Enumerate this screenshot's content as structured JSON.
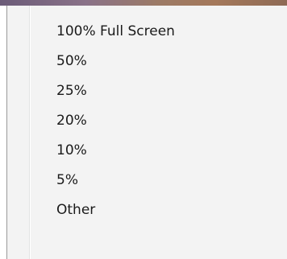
{
  "menu": {
    "items": [
      {
        "label": "100% Full Screen"
      },
      {
        "label": "50%"
      },
      {
        "label": "25%"
      },
      {
        "label": "20%"
      },
      {
        "label": "10%"
      },
      {
        "label": "5%"
      },
      {
        "label": "Other"
      }
    ]
  }
}
